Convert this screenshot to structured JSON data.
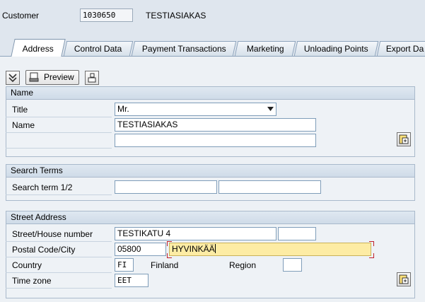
{
  "header": {
    "customer_label": "Customer",
    "customer_number": "1030650",
    "customer_name": "TESTIASIAKAS"
  },
  "tabs": [
    {
      "label": "Address",
      "selected": true
    },
    {
      "label": "Control Data",
      "selected": false
    },
    {
      "label": "Payment Transactions",
      "selected": false
    },
    {
      "label": "Marketing",
      "selected": false
    },
    {
      "label": "Unloading Points",
      "selected": false
    },
    {
      "label": "Export Da",
      "selected": false
    }
  ],
  "toolbar": {
    "preview_label": "Preview"
  },
  "name_group": {
    "title": "Name",
    "title_label": "Title",
    "title_value": "Mr.",
    "name_label": "Name",
    "name_value": "TESTIASIAKAS",
    "name2_value": ""
  },
  "search_group": {
    "title": "Search Terms",
    "search_label": "Search term 1/2",
    "search1_value": "",
    "search2_value": ""
  },
  "street_group": {
    "title": "Street Address",
    "street_label": "Street/House number",
    "street_value": "TESTIKATU 4",
    "house_value": "",
    "postal_label": "Postal Code/City",
    "postal_value": "05800",
    "city_value": "HYVINKÄÄ",
    "country_label": "Country",
    "country_value": "FI",
    "country_name": "Finland",
    "region_label": "Region",
    "region_value": "",
    "timezone_label": "Time zone",
    "timezone_value": "EET"
  },
  "colors": {
    "active_field": "#fdeca4",
    "panel_background": "#edf1f5"
  }
}
